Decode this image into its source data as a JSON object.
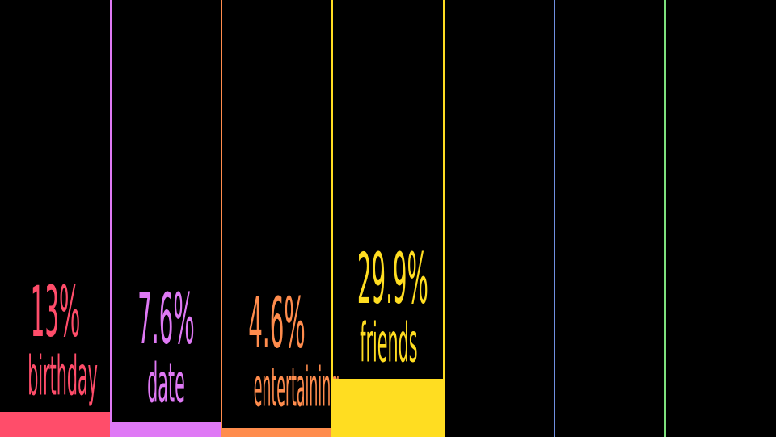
{
  "chart_data": {
    "type": "bar",
    "categories": [
      "birthday",
      "date",
      "entertaining",
      "friends",
      "",
      "",
      ""
    ],
    "values": [
      13,
      7.6,
      4.6,
      29.9,
      null,
      null,
      null
    ],
    "value_labels": [
      "13%",
      "7.6%",
      "4.6%",
      "29.9%",
      "",
      "",
      ""
    ],
    "unit": "%",
    "ylim": [
      0,
      100
    ],
    "grid": false,
    "legend": "none",
    "colors": [
      "#ff4d6a",
      "#df79f5",
      "#ff8c4d",
      "#ffdd21",
      "#ffdd21",
      "#6f8fe0",
      "#7de07d"
    ]
  }
}
